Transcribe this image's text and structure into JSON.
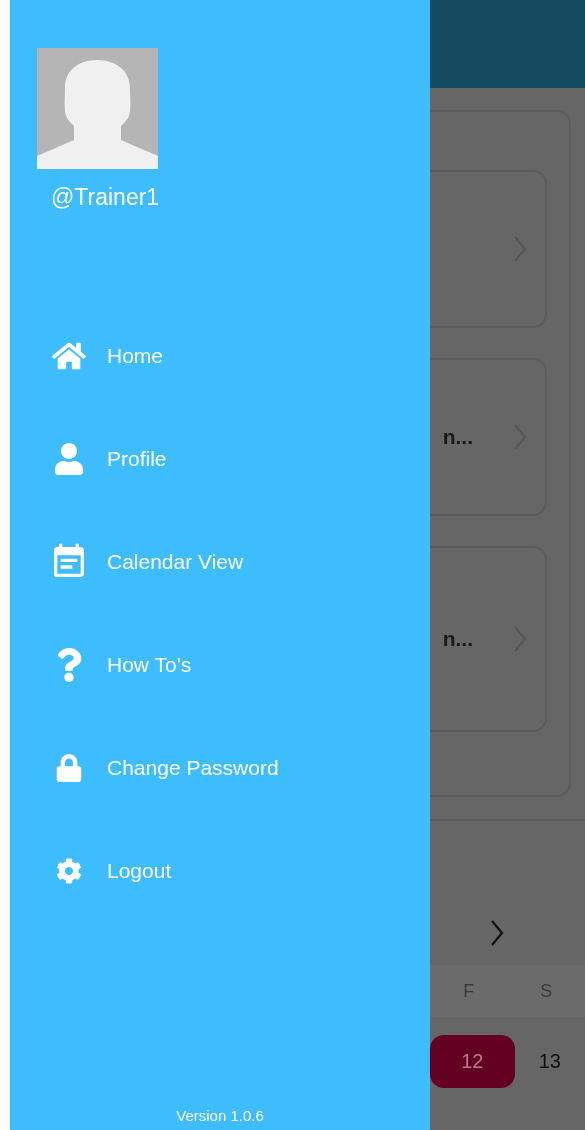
{
  "profile": {
    "username": "@Trainer1"
  },
  "menu": [
    {
      "label": "Home",
      "kind": "home"
    },
    {
      "label": "Profile",
      "kind": "user"
    },
    {
      "label": "Calendar View",
      "kind": "calendar"
    },
    {
      "label": "How To's",
      "kind": "question"
    },
    {
      "label": "Change Password",
      "kind": "lock"
    },
    {
      "label": "Logout",
      "kind": "gear"
    }
  ],
  "version": "Version 1.0.6",
  "background": {
    "cards": [
      {
        "kind": "plain"
      },
      {
        "kind": "text",
        "text": "n..."
      },
      {
        "kind": "text",
        "text": "n..."
      }
    ],
    "weekdays": [
      "F",
      "S"
    ],
    "dates": [
      {
        "label": "12",
        "selected": true
      },
      {
        "label": "13",
        "selected": false
      }
    ]
  }
}
